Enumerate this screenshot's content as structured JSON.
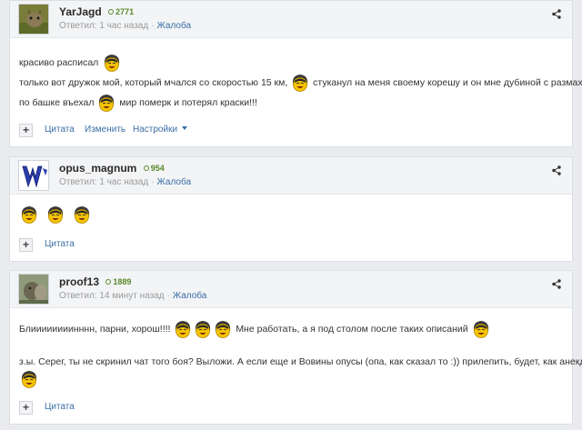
{
  "icons": {
    "share": "share-icon",
    "smiley": "laughing-smiley-icon",
    "quote_plus": "plus-icon"
  },
  "colors": {
    "link": "#3a6ea5",
    "reputation": "#5a8a2a",
    "header_bg": "#f3f4f6"
  },
  "posts": [
    {
      "username": "YarJagd",
      "reputation": "2771",
      "meta": {
        "answered": "Ответил: 1 час назад",
        "report": "Жалоба"
      },
      "lines": [
        {
          "text": "красиво расписал"
        },
        {
          "text_a": "только вот дружок мой, который мчался со скоростью 15 км,",
          "text_b": "стуканул на меня своему корешу и он мне дубиной с размаху"
        },
        {
          "text_a": "по башке въехал",
          "text_b": "мир померк и потерял краски!!!"
        }
      ],
      "actions": {
        "quote": "Цитата",
        "edit": "Изменить",
        "settings": "Настройки"
      }
    },
    {
      "username": "opus_magnum",
      "reputation": "954",
      "meta": {
        "answered": "Ответил: 1 час назад",
        "report": "Жалоба"
      },
      "actions": {
        "quote": "Цитата"
      }
    },
    {
      "username": "proof13",
      "reputation": "1889",
      "meta": {
        "answered": "Ответил: 14 минут назад",
        "report": "Жалоба"
      },
      "lines": [
        {
          "text_a": "Блиииииииинннн, парни, хорош!!!!",
          "text_b": "Мне работать, а я под столом после таких описаний"
        },
        {
          "text": "з.ы. Серег, ты не скринил чат того боя? Выложи. А если еще и Вовины опусы (опа, как сказал то :)) прилепить, будет, как анекдот"
        }
      ],
      "actions": {
        "quote": "Цитата"
      }
    }
  ]
}
